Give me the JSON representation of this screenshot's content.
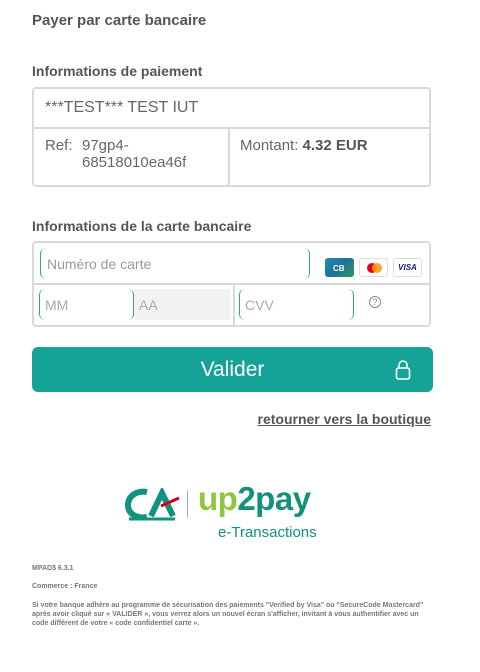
{
  "page": {
    "title": "Payer par carte bancaire"
  },
  "payment_info": {
    "section_label": "Informations de paiement",
    "merchant": "***TEST*** TEST IUT",
    "ref_label": "Ref:",
    "ref_value": "97gp4-68518010ea46f",
    "amount_label": "Montant:",
    "amount_value": "4.32 EUR"
  },
  "card_info": {
    "section_label": "Informations de la carte bancaire",
    "card_number_placeholder": "Numéro de carte",
    "card_number_value": "",
    "month_placeholder": "MM",
    "year_placeholder": "AA",
    "cvv_placeholder": "CVV",
    "help_symbol": "?",
    "brands": [
      {
        "name": "CB",
        "icon": "cb-card-icon",
        "color": "#1f6f9a"
      },
      {
        "name": "Mastercard",
        "icon": "mastercard-icon",
        "color": "#eb001b"
      },
      {
        "name": "VISA",
        "icon": "visa-icon",
        "color": "#1a1f71"
      }
    ]
  },
  "actions": {
    "submit_label": "Valider",
    "back_link": "retourner vers la boutique"
  },
  "branding": {
    "logo_text_up": "up",
    "logo_text_2pay": "2pay",
    "logo_subtitle": "e-Transactions",
    "accent_color": "#16a397"
  },
  "footer": {
    "version": "MPAD$ 6.3.1",
    "commerce": "Commerce : France",
    "disclaimer": "Si votre banque adhère au programme de sécurisation des paiements \"Verified by Visa\" ou \"SecureCode Mastercard\" après avoir cliqué sur « VALIDER », vous verrez alors un nouvel écran s'afficher, invitant à vous authentifier avec un code différent de votre « code confidentiel carte »."
  }
}
